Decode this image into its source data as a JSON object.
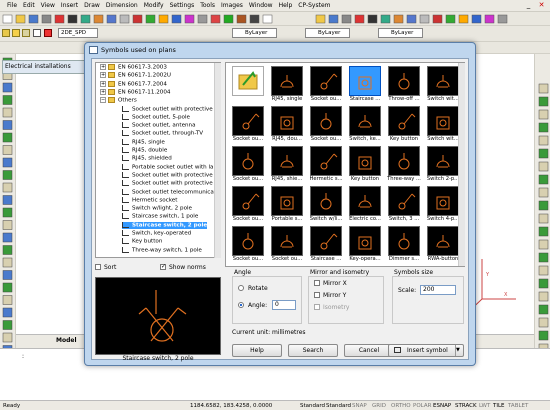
{
  "menu": {
    "items": [
      "File",
      "Edit",
      "View",
      "Insert",
      "Draw",
      "Dimension",
      "Modify",
      "Settings",
      "Tools",
      "Images",
      "Window",
      "Help",
      "CP-System"
    ]
  },
  "toolbar": {
    "layer_value": "2DE_SPD",
    "bylayer_1": "ByLayer",
    "bylayer_2": "ByLayer",
    "bylayer_3": "ByLayer"
  },
  "palette": {
    "title": "Electrical installations"
  },
  "dialog": {
    "title": "Symbols used on plans",
    "tree": [
      {
        "label": "EN 60617-3.2003",
        "kind": "folder",
        "level": 0
      },
      {
        "label": "EN 60617-1.2002U",
        "kind": "folder",
        "level": 0
      },
      {
        "label": "EN 60617-7.2004",
        "kind": "folder",
        "level": 0
      },
      {
        "label": "EN 60617-11.2004",
        "kind": "folder",
        "level": 0
      },
      {
        "label": "Others",
        "kind": "folder-open",
        "level": 0
      },
      {
        "label": "Socket outlet with protective cor",
        "kind": "item",
        "level": 1
      },
      {
        "label": "Socket outlet, 5-pole",
        "kind": "item",
        "level": 1
      },
      {
        "label": "Socket outlet, antenna",
        "kind": "item",
        "level": 1
      },
      {
        "label": "Socket outlet, through-TV",
        "kind": "item",
        "level": 1
      },
      {
        "label": "RJ45, single",
        "kind": "item",
        "level": 1
      },
      {
        "label": "RJ45, double",
        "kind": "item",
        "level": 1
      },
      {
        "label": "RJ45, shielded",
        "kind": "item",
        "level": 1
      },
      {
        "label": "Portable socket outlet with lamp",
        "kind": "item",
        "level": 1
      },
      {
        "label": "Socket outlet with protective cor",
        "kind": "item",
        "level": 1
      },
      {
        "label": "Socket outlet with protective cor",
        "kind": "item",
        "level": 1
      },
      {
        "label": "Socket outlet telecommunication",
        "kind": "item",
        "level": 1
      },
      {
        "label": "Hermetic socket",
        "kind": "item",
        "level": 1
      },
      {
        "label": "Switch w/light, 2 pole",
        "kind": "item",
        "level": 1
      },
      {
        "label": "Staircase switch, 1 pole",
        "kind": "item",
        "level": 1
      },
      {
        "label": "Staircase switch, 2 pole",
        "kind": "item-selected",
        "level": 1
      },
      {
        "label": "Switch, key-operated",
        "kind": "item",
        "level": 1
      },
      {
        "label": "Key button",
        "kind": "item",
        "level": 1
      },
      {
        "label": "Three-way switch, 1 pole",
        "kind": "item",
        "level": 1
      }
    ],
    "symbols": [
      {
        "label": "",
        "selected": false
      },
      {
        "label": "RJ45, single",
        "selected": false
      },
      {
        "label": "Socket ou...",
        "selected": false
      },
      {
        "label": "Staircase ...",
        "selected": true
      },
      {
        "label": "Throw-off ...",
        "selected": false
      },
      {
        "label": "Switch wit...",
        "selected": false
      },
      {
        "label": "Socket ou...",
        "selected": false
      },
      {
        "label": "RJ45, dou...",
        "selected": false
      },
      {
        "label": "Socket ou...",
        "selected": false
      },
      {
        "label": "Switch, ke...",
        "selected": false
      },
      {
        "label": "Key button",
        "selected": false
      },
      {
        "label": "Switch wit...",
        "selected": false
      },
      {
        "label": "Socket ou...",
        "selected": false
      },
      {
        "label": "RJ45, shie...",
        "selected": false
      },
      {
        "label": "Hermetic s...",
        "selected": false
      },
      {
        "label": "Key button",
        "selected": false
      },
      {
        "label": "Three-way ...",
        "selected": false
      },
      {
        "label": "Switch 2-p...",
        "selected": false
      },
      {
        "label": "Socket ou...",
        "selected": false
      },
      {
        "label": "Portable s...",
        "selected": false
      },
      {
        "label": "Switch w/li...",
        "selected": false
      },
      {
        "label": "Electric co...",
        "selected": false
      },
      {
        "label": "Switch, 3 ...",
        "selected": false
      },
      {
        "label": "Switch 4-p...",
        "selected": false
      },
      {
        "label": "Socket ou...",
        "selected": false
      },
      {
        "label": "Socket ou...",
        "selected": false
      },
      {
        "label": "Staircase ...",
        "selected": false
      },
      {
        "label": "Key-opera...",
        "selected": false
      },
      {
        "label": "Dimmer s...",
        "selected": false
      },
      {
        "label": "RWA-button",
        "selected": false
      }
    ],
    "sort_label": "Sort",
    "show_norms_label": "Show norms",
    "angle_group": "Angle",
    "rotate_label": "Rotate",
    "angle_label": "Angle:",
    "angle_value": "0",
    "mirror_group": "Mirror and isometry",
    "mirror_x": "Mirror X",
    "mirror_y": "Mirror Y",
    "isometry": "Isometry",
    "size_group": "Symbols size",
    "scale_label": "Scale:",
    "scale_value": "200",
    "current_unit": "Current unit: millimetres",
    "preview_label": "Staircase switch, 2 pole",
    "help_button": "Help",
    "search_button": "Search",
    "cancel_button": "Cancel",
    "insert_button": "Insert symbol"
  },
  "layout_tabs": {
    "model": "Model"
  },
  "status": {
    "ready": "Ready",
    "coords": "1184.6582, 183.4258, 0.0000",
    "standard_1": "Standard",
    "standard_2": "Standard",
    "modes": [
      "SNAP",
      "GRID",
      "ORTHO",
      "POLAR",
      "ESNAP",
      "STRACK",
      "LWT",
      "TILE",
      "TABLET"
    ]
  },
  "colors": {
    "accent": "#3399ff",
    "symbol_bg": "#000000",
    "symbol_orange": "#e07020",
    "dialog_frame": "#bfd6ee"
  }
}
